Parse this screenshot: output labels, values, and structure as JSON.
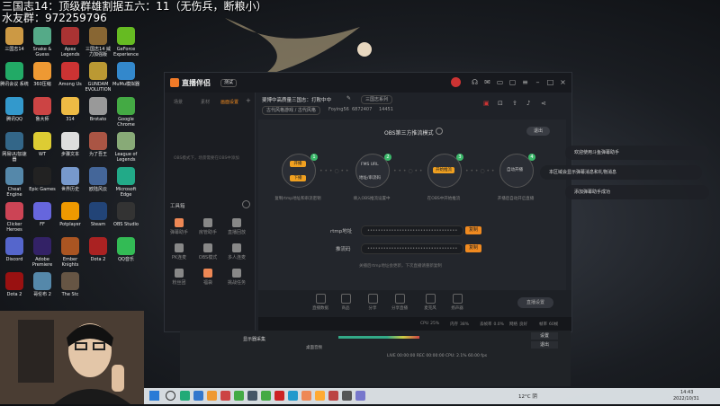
{
  "overlay": {
    "line1": "三国志14：顶级群雄割据五六：11（无伤兵，断粮小）",
    "line2": "水友群：972259796"
  },
  "desktop_icons": [
    {
      "label": "三国志14",
      "color": "#c94"
    },
    {
      "label": "Snake & Guess",
      "color": "#5a8"
    },
    {
      "label": "Apex Legends",
      "color": "#a33"
    },
    {
      "label": "三国志14 威力加强版",
      "color": "#863"
    },
    {
      "label": "GeForce Experience",
      "color": "#6b2"
    },
    {
      "label": "腾讯会议 系统",
      "color": "#2a6"
    },
    {
      "label": "360压缩",
      "color": "#e93"
    },
    {
      "label": "Among Us",
      "color": "#c33"
    },
    {
      "label": "GUNDAM EVOLUTION",
      "color": "#b93"
    },
    {
      "label": "MuMu模拟器",
      "color": "#38c"
    },
    {
      "label": "腾讯QQ",
      "color": "#39c"
    },
    {
      "label": "鲁大师",
      "color": "#c44"
    },
    {
      "label": "314",
      "color": "#eb4"
    },
    {
      "label": "Brotato",
      "color": "#999"
    },
    {
      "label": "Google Chrome",
      "color": "#4a4"
    },
    {
      "label": "网易UU加速器",
      "color": "#368"
    },
    {
      "label": "WT",
      "color": "#dc3"
    },
    {
      "label": "步骤文本",
      "color": "#ddd"
    },
    {
      "label": "为了吾王",
      "color": "#a54"
    },
    {
      "label": "League of Legends",
      "color": "#8a7"
    },
    {
      "label": "Cheat Engine",
      "color": "#58a"
    },
    {
      "label": "Epic Games",
      "color": "#222"
    },
    {
      "label": "世界历史",
      "color": "#79c"
    },
    {
      "label": "欧陆风云",
      "color": "#469"
    },
    {
      "label": "Microsoft Edge",
      "color": "#2a8"
    },
    {
      "label": "Clicker Heroes",
      "color": "#c45"
    },
    {
      "label": "FF",
      "color": "#66d"
    },
    {
      "label": "Potplayer",
      "color": "#e90"
    },
    {
      "label": "Steam",
      "color": "#247"
    },
    {
      "label": "OBS Studio",
      "color": "#333"
    },
    {
      "label": "Discord",
      "color": "#56c"
    },
    {
      "label": "Adobe Premiere",
      "color": "#326"
    },
    {
      "label": "Ember Knights",
      "color": "#a52"
    },
    {
      "label": "Dota 2",
      "color": "#a22"
    },
    {
      "label": "QQ音乐",
      "color": "#3b5"
    },
    {
      "label": "Dota 2",
      "color": "#911"
    },
    {
      "label": "哥伦布 2",
      "color": "#58a"
    },
    {
      "label": "The Stc",
      "color": "#654"
    }
  ],
  "app": {
    "title": "直播伴侣",
    "badge": "测试",
    "left_tabs": [
      "场景",
      "素材",
      "画面设置"
    ],
    "left_empty_hint": "OBS模式下，场景需要在OBS中添加",
    "tools_header": "工具箱",
    "tools": [
      {
        "label": "弹幕助手",
        "color": "#e85"
      },
      {
        "label": "房管助手",
        "color": "#888"
      },
      {
        "label": "直播回放",
        "color": "#888"
      },
      {
        "label": "PK连麦",
        "color": "#888"
      },
      {
        "label": "OBS模式",
        "color": "#888"
      },
      {
        "label": "多人连麦",
        "color": "#888"
      },
      {
        "label": "粉丝团",
        "color": "#888"
      },
      {
        "label": "福袋",
        "color": "#e85"
      },
      {
        "label": "挑战任务",
        "color": "#888"
      }
    ],
    "room_title": "斐博中高质量三国志：打败中中",
    "room_sub": "三国志系列",
    "room_tag": "古代风格游戏 / 古代风格",
    "room_id": "Foying56",
    "followers": "6872407",
    "viewers": "14451",
    "obs_title": "OBS第三方推流模式",
    "exit_label": "退出",
    "steps": [
      {
        "n": "1",
        "btns": [
          "开播",
          "下播"
        ],
        "caption": "复制rtmp地址和串流密钥"
      },
      {
        "n": "2",
        "btns": [
          "FMS URL",
          "地址/串流码"
        ],
        "caption": "填入OBS推流设置中"
      },
      {
        "n": "3",
        "btns": [
          "开始推流"
        ],
        "caption": "在OBS中开始推流"
      },
      {
        "n": "4",
        "btns": [
          "自动开播"
        ],
        "caption": "开播后自动开启直播"
      }
    ],
    "rtmp_label": "rtmp地址",
    "rtmp_value": "••••••••••••••••••••••••••••••••••",
    "key_label": "推流码",
    "key_value": "••••••••••••••••••••••••••••••••••",
    "copy_label": "复制",
    "hint": "关播后rtmp地址会更新，下次直播请重新复制",
    "bottom_tools": [
      "直播数据",
      "商品",
      "分享",
      "分享直播",
      "麦克风",
      "扬声器"
    ],
    "bottom_right": "直播设置",
    "status": [
      {
        "label": "CPU",
        "value": "25%"
      },
      {
        "label": "内存",
        "value": "38%"
      },
      {
        "label": "丢帧率",
        "value": "0.0%"
      },
      {
        "label": "网络",
        "value": "良好"
      },
      {
        "label": "帧率",
        "value": "60帧"
      }
    ]
  },
  "notifications": [
    "欢迎使用斗鱼弹幕助手",
    "本区域会显示弹幕消息和礼物消息",
    "添加弹幕助手成功"
  ],
  "obs_panel": {
    "rows": [
      "显示器采集",
      "桌面音频"
    ],
    "buttons": [
      "设置",
      "退出"
    ],
    "status": "LIVE 00:00:00  REC 00:00:00  CPU: 2.1% 60.00 fps"
  },
  "taskbar": {
    "weather": "12°C 阴",
    "time": "14:43",
    "date": "2022/10/31",
    "icons": [
      "#2a7",
      "#37c",
      "#e93",
      "#c44",
      "#4a4",
      "#456",
      "#4a4",
      "#c22",
      "#29c",
      "#e85",
      "#fa3",
      "#b44",
      "#555",
      "#77c"
    ]
  }
}
